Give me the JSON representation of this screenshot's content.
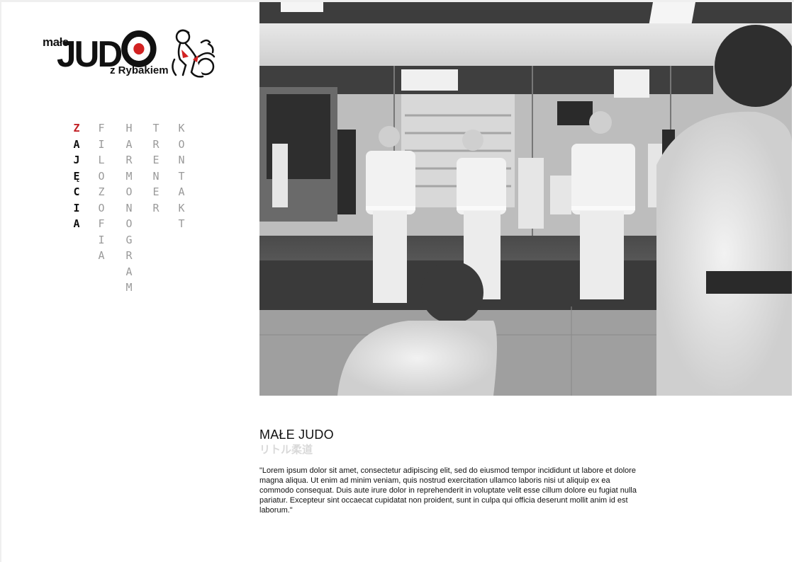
{
  "logo": {
    "small_text": "małe",
    "big_text_prefix": "JUD",
    "sub_text": "z Rybakiem",
    "brand_red": "#d22222"
  },
  "nav": {
    "items": [
      {
        "label": "ZAJĘCIA",
        "active": true
      },
      {
        "label": "FILOZOFIA",
        "active": false
      },
      {
        "label": "HARMONOGRAM",
        "active": false
      },
      {
        "label": "TRENER",
        "active": false
      },
      {
        "label": "KONTAKT",
        "active": false
      }
    ],
    "active_color": "#111111",
    "active_first_letter_color": "#c22126",
    "inactive_color": "#9a9a9a"
  },
  "section": {
    "title": "MAŁE JUDO",
    "subtitle": "リトル柔道",
    "body": "\"Lorem ipsum dolor sit amet, consectetur adipiscing elit, sed do eiusmod tempor incididunt ut labore et dolore magna aliqua. Ut enim ad minim veniam, quis nostrud exercitation ullamco laboris nisi ut aliquip ex ea commodo consequat. Duis aute irure dolor in reprehenderit in voluptate velit esse cillum dolore eu fugiat nulla pariatur. Excepteur sint occaecat cupidatat non proident, sunt in culpa qui officia deserunt mollit anim id est laborum.\""
  }
}
